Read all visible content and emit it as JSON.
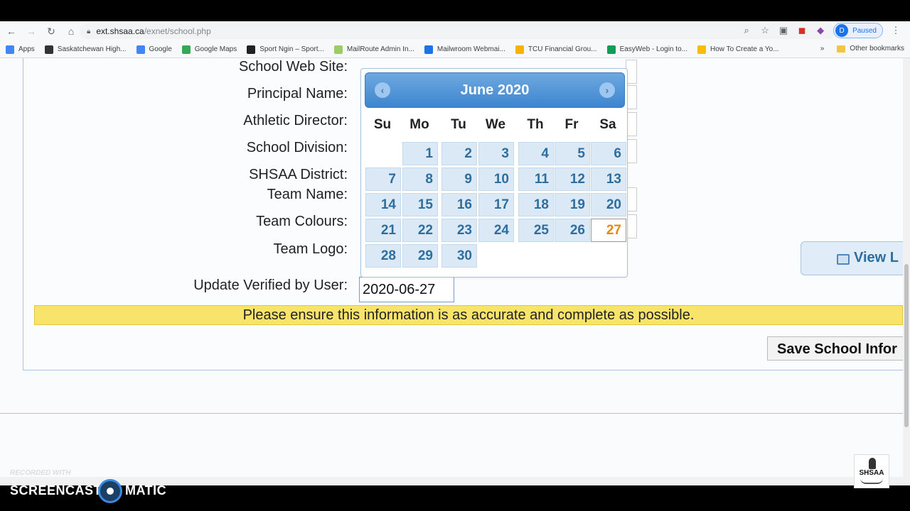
{
  "browser": {
    "url_host": "ext.shsaa.ca",
    "url_path": "/exnet/school.php",
    "profile_label": "Paused",
    "profile_initial": "D",
    "bookmarks": [
      {
        "label": "Apps",
        "color": "#4285f4"
      },
      {
        "label": "Saskatchewan High...",
        "color": "#333333"
      },
      {
        "label": "Google",
        "color": "#4285f4"
      },
      {
        "label": "Google Maps",
        "color": "#34a853"
      },
      {
        "label": "Sport Ngin – Sport...",
        "color": "#222222"
      },
      {
        "label": "MailRoute Admin In...",
        "color": "#9ccc65"
      },
      {
        "label": "Mailwroom Webmai...",
        "color": "#1a73e8"
      },
      {
        "label": "TCU Financial Grou...",
        "color": "#f4b400"
      },
      {
        "label": "EasyWeb - Login to...",
        "color": "#0f9d58"
      },
      {
        "label": "How To Create a Yo...",
        "color": "#fbbc05"
      }
    ],
    "bookmarks_more": "»",
    "other_bookmarks": "Other bookmarks"
  },
  "form": {
    "labels": {
      "school_web_site": "School Web Site:",
      "principal_name": "Principal Name:",
      "athletic_director": "Athletic Director:",
      "school_division": "School Division:",
      "shsaa_district": "SHSAA District:",
      "team_name": "Team Name:",
      "team_colours": "Team Colours:",
      "team_logo": "Team Logo:",
      "update_verified": "Update Verified by User:"
    },
    "update_verified_value": "2020-06-27",
    "notice": "Please ensure this information is as accurate and complete as possible.",
    "save_button": "Save School Infor",
    "view_button": "View L"
  },
  "datepicker": {
    "title": "June 2020",
    "prev": "‹",
    "next": "›",
    "weekdays": [
      "Su",
      "Mo",
      "Tu",
      "We",
      "Th",
      "Fr",
      "Sa"
    ],
    "first_weekday_index": 1,
    "days_in_month": 30,
    "selected_day": 27
  },
  "watermark": {
    "recorded_with": "RECORDED WITH",
    "screencast": "SCREENCAST",
    "matic": "MATIC",
    "logo_text": "SHSAA"
  },
  "colors": {
    "header_blue": "#3d85cf",
    "cell_blue": "#dbe8f5",
    "notice_yellow": "#f8e36b",
    "selected_day_orange": "#e28a18"
  }
}
